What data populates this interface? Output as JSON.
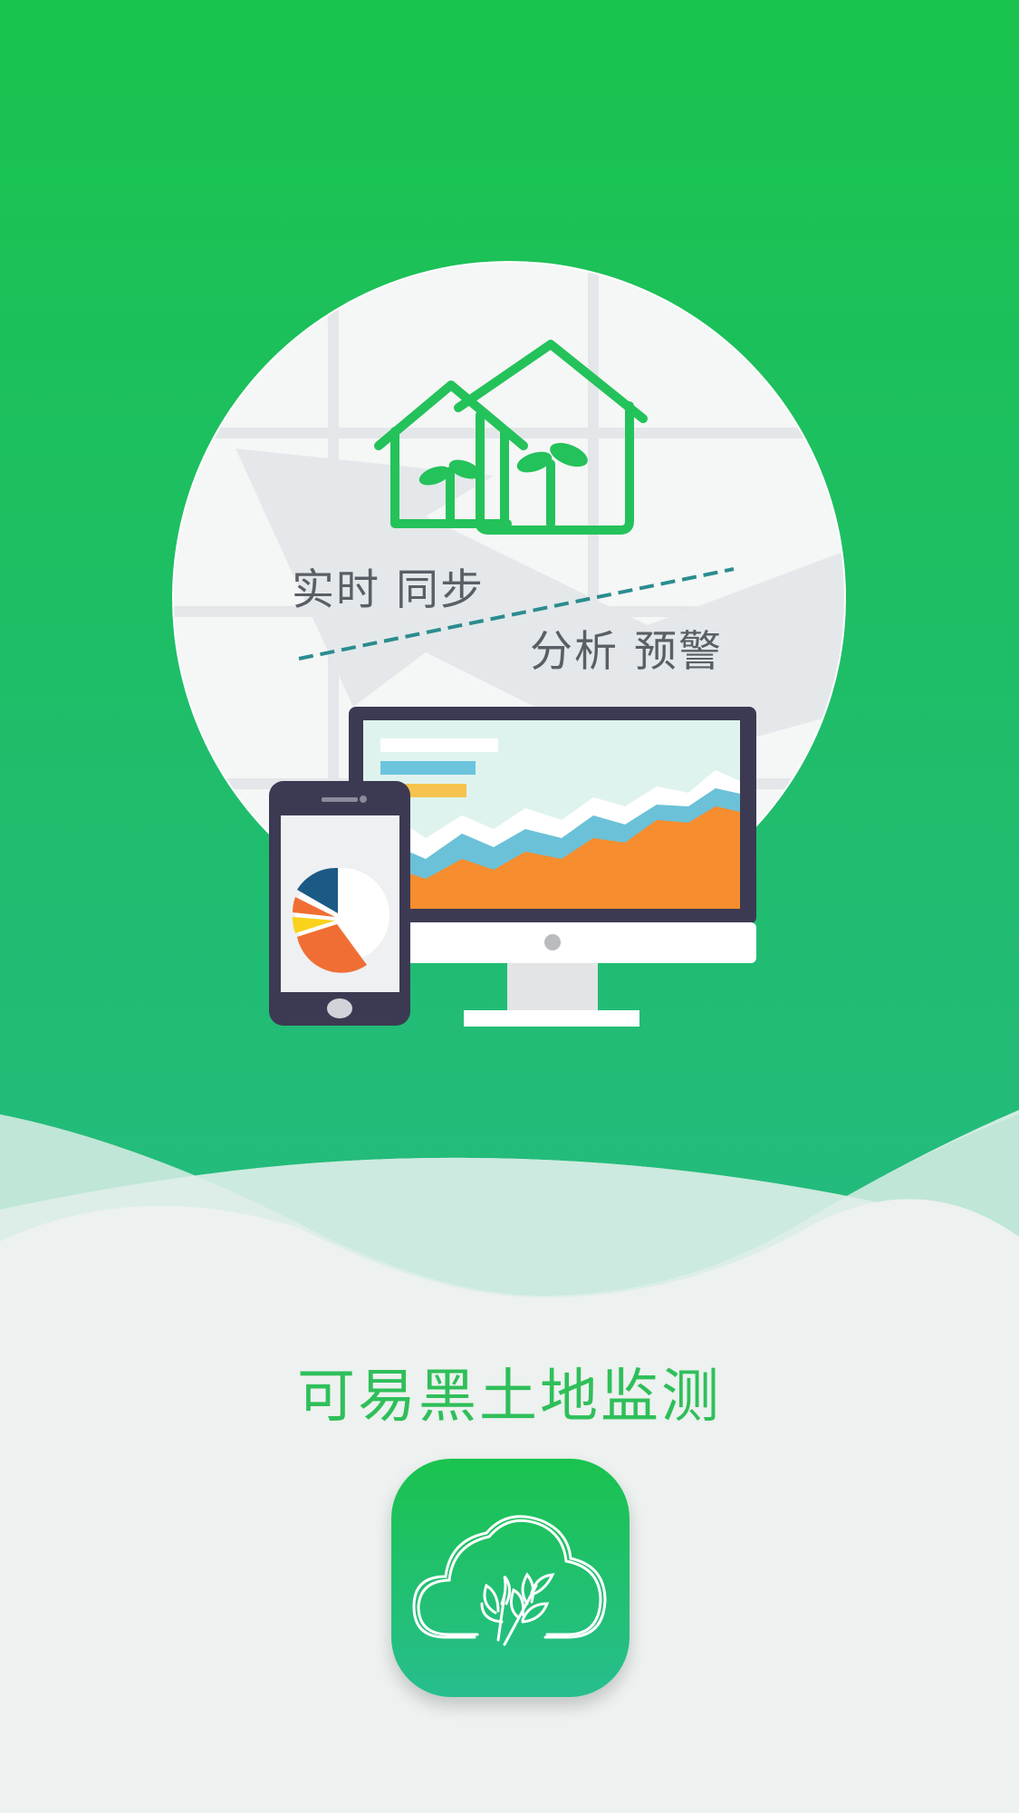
{
  "splash": {
    "tagline_left": "实时 同步",
    "tagline_right": "分析 预警",
    "app_name": "可易黑土地监测"
  },
  "icons": {
    "illustration": "greenhouse-icon",
    "devices": "monitor-and-phone-icon",
    "app_logo": "cloud-wheat-icon"
  },
  "colors": {
    "brand_green": "#1ac34d",
    "app_name_green": "#2fbf5a",
    "background": "#edf1ef"
  }
}
